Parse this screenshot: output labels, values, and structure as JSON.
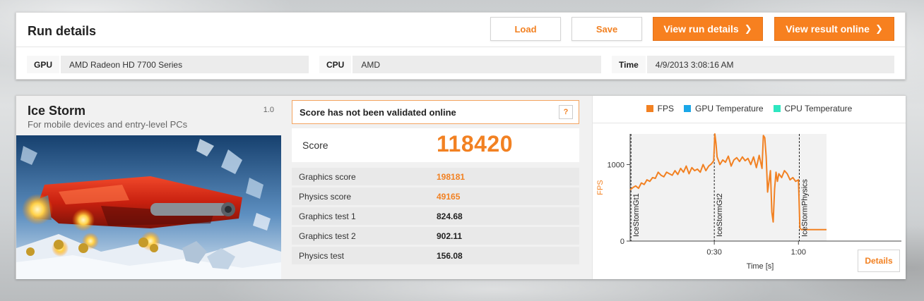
{
  "run": {
    "title": "Run details",
    "buttons": {
      "load": "Load",
      "save": "Save",
      "view_run_details": "View run details",
      "view_result_online": "View result online"
    },
    "gpu_label": "GPU",
    "gpu_value": "AMD Radeon HD 7700 Series",
    "cpu_label": "CPU",
    "cpu_value": "AMD",
    "time_label": "Time",
    "time_value": "4/9/2013 3:08:16 AM"
  },
  "test": {
    "name": "Ice Storm",
    "version": "1.0",
    "description": "For mobile devices and entry-level PCs"
  },
  "score": {
    "validation_message": "Score has not been validated online",
    "help_label": "?",
    "label": "Score",
    "value": "118420",
    "rows": [
      {
        "label": "Graphics score",
        "value": "198181",
        "highlight": true
      },
      {
        "label": "Physics score",
        "value": "49165",
        "highlight": true
      },
      {
        "label": "Graphics test 1",
        "value": "824.68",
        "highlight": false
      },
      {
        "label": "Graphics test 2",
        "value": "902.11",
        "highlight": false
      },
      {
        "label": "Physics test",
        "value": "156.08",
        "highlight": false
      }
    ]
  },
  "colors": {
    "accent": "#f28122",
    "fps": "#f28122",
    "gpu_temp": "#1aa7e8",
    "cpu_temp": "#2ee6c0"
  },
  "chart_data": {
    "type": "line",
    "legend": [
      {
        "name": "FPS",
        "color": "#f28122"
      },
      {
        "name": "GPU Temperature",
        "color": "#1aa7e8"
      },
      {
        "name": "CPU Temperature",
        "color": "#2ee6c0"
      }
    ],
    "ylabel": "FPS",
    "xlabel": "Time [s]",
    "ylim": [
      0,
      1400
    ],
    "xlim": [
      0,
      70
    ],
    "yticks": [
      {
        "value": 0,
        "label": "0"
      },
      {
        "value": 1000,
        "label": "1000"
      }
    ],
    "xticks": [
      {
        "value": 30,
        "label": "0:30"
      },
      {
        "value": 60,
        "label": "1:00"
      }
    ],
    "markers": [
      {
        "x": 0.3,
        "label": "IceStormGt1"
      },
      {
        "x": 30,
        "label": "IceStormGt2"
      },
      {
        "x": 60.3,
        "label": "IceStormPhysics"
      }
    ],
    "series": [
      {
        "name": "FPS",
        "x": [
          0,
          1,
          2,
          3,
          4,
          5,
          6,
          7,
          8,
          9,
          10,
          11,
          12,
          13,
          14,
          15,
          16,
          17,
          18,
          19,
          20,
          21,
          22,
          23,
          24,
          25,
          26,
          27,
          28,
          29,
          29.8,
          30.2,
          30.6,
          31,
          32,
          33,
          34,
          35,
          36,
          37,
          38,
          39,
          40,
          41,
          42,
          43,
          44,
          45,
          46,
          47,
          47.5,
          48,
          48.5,
          49,
          49.5,
          50,
          50.5,
          51,
          51.5,
          52,
          52.5,
          53,
          54,
          55,
          56,
          57,
          58,
          59,
          60,
          60.5,
          61,
          62,
          64,
          66,
          68,
          70
        ],
        "y": [
          670,
          700,
          720,
          690,
          760,
          740,
          800,
          780,
          830,
          820,
          900,
          860,
          840,
          900,
          880,
          860,
          920,
          870,
          950,
          900,
          980,
          880,
          960,
          920,
          940,
          900,
          1000,
          920,
          980,
          1010,
          1050,
          1400,
          1280,
          1100,
          1000,
          1060,
          1030,
          1110,
          980,
          1060,
          1090,
          1040,
          1100,
          1050,
          1080,
          1000,
          1100,
          960,
          1120,
          950,
          1380,
          1350,
          1100,
          640,
          780,
          920,
          380,
          250,
          680,
          900,
          780,
          880,
          830,
          920,
          880,
          800,
          830,
          780,
          800,
          170,
          150,
          150,
          150,
          150,
          150,
          150
        ]
      }
    ]
  }
}
